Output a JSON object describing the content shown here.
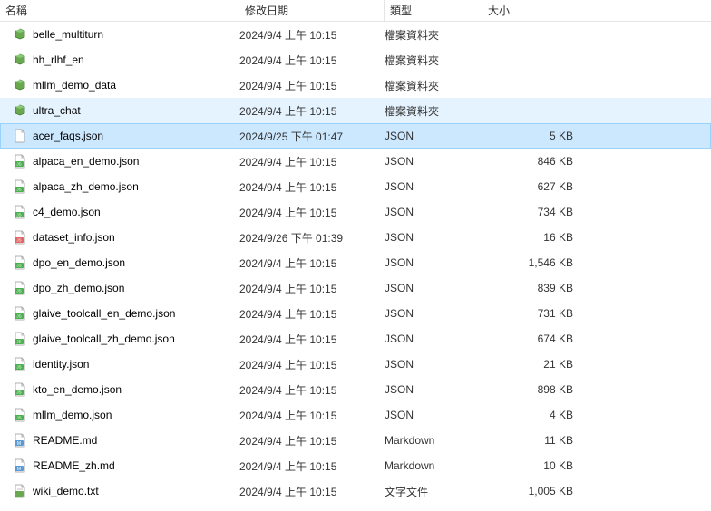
{
  "columns": {
    "name": "名稱",
    "date": "修改日期",
    "type": "類型",
    "size": "大小"
  },
  "files": [
    {
      "name": "belle_multiturn",
      "date": "2024/9/4 上午 10:15",
      "type": "檔案資料夾",
      "size": "",
      "icon": "folder-hex"
    },
    {
      "name": "hh_rlhf_en",
      "date": "2024/9/4 上午 10:15",
      "type": "檔案資料夾",
      "size": "",
      "icon": "folder-hex"
    },
    {
      "name": "mllm_demo_data",
      "date": "2024/9/4 上午 10:15",
      "type": "檔案資料夾",
      "size": "",
      "icon": "folder-hex"
    },
    {
      "name": "ultra_chat",
      "date": "2024/9/4 上午 10:15",
      "type": "檔案資料夾",
      "size": "",
      "icon": "folder-hex",
      "state": "hover"
    },
    {
      "name": "acer_faqs.json",
      "date": "2024/9/25 下午 01:47",
      "type": "JSON",
      "size": "5 KB",
      "icon": "json-plain",
      "state": "selected"
    },
    {
      "name": "alpaca_en_demo.json",
      "date": "2024/9/4 上午 10:15",
      "type": "JSON",
      "size": "846 KB",
      "icon": "json"
    },
    {
      "name": "alpaca_zh_demo.json",
      "date": "2024/9/4 上午 10:15",
      "type": "JSON",
      "size": "627 KB",
      "icon": "json"
    },
    {
      "name": "c4_demo.json",
      "date": "2024/9/4 上午 10:15",
      "type": "JSON",
      "size": "734 KB",
      "icon": "json"
    },
    {
      "name": "dataset_info.json",
      "date": "2024/9/26 下午 01:39",
      "type": "JSON",
      "size": "16 KB",
      "icon": "json-e"
    },
    {
      "name": "dpo_en_demo.json",
      "date": "2024/9/4 上午 10:15",
      "type": "JSON",
      "size": "1,546 KB",
      "icon": "json"
    },
    {
      "name": "dpo_zh_demo.json",
      "date": "2024/9/4 上午 10:15",
      "type": "JSON",
      "size": "839 KB",
      "icon": "json"
    },
    {
      "name": "glaive_toolcall_en_demo.json",
      "date": "2024/9/4 上午 10:15",
      "type": "JSON",
      "size": "731 KB",
      "icon": "json"
    },
    {
      "name": "glaive_toolcall_zh_demo.json",
      "date": "2024/9/4 上午 10:15",
      "type": "JSON",
      "size": "674 KB",
      "icon": "json"
    },
    {
      "name": "identity.json",
      "date": "2024/9/4 上午 10:15",
      "type": "JSON",
      "size": "21 KB",
      "icon": "json"
    },
    {
      "name": "kto_en_demo.json",
      "date": "2024/9/4 上午 10:15",
      "type": "JSON",
      "size": "898 KB",
      "icon": "json"
    },
    {
      "name": "mllm_demo.json",
      "date": "2024/9/4 上午 10:15",
      "type": "JSON",
      "size": "4 KB",
      "icon": "json"
    },
    {
      "name": "README.md",
      "date": "2024/9/4 上午 10:15",
      "type": "Markdown",
      "size": "11 KB",
      "icon": "md"
    },
    {
      "name": "README_zh.md",
      "date": "2024/9/4 上午 10:15",
      "type": "Markdown",
      "size": "10 KB",
      "icon": "md"
    },
    {
      "name": "wiki_demo.txt",
      "date": "2024/9/4 上午 10:15",
      "type": "文字文件",
      "size": "1,005 KB",
      "icon": "txt"
    }
  ]
}
